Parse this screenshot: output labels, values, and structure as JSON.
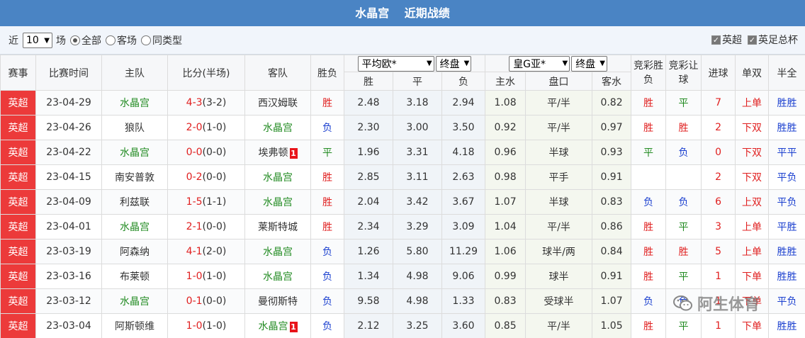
{
  "title": {
    "team": "水晶宫",
    "label": "近期战绩"
  },
  "filter": {
    "prefix": "近",
    "count": "10",
    "suffix": "场",
    "options": [
      "全部",
      "客场",
      "同类型"
    ],
    "selected": "全部",
    "checks": [
      "英超",
      "英足总杯"
    ]
  },
  "header": {
    "league": "赛事",
    "date": "比赛时间",
    "home": "主队",
    "score": "比分(半场)",
    "away": "客队",
    "result": "胜负",
    "euro_company": "平均欧*",
    "euro_mode": "终盘",
    "asia_company": "皇G亚*",
    "asia_mode": "终盘",
    "lottery_result": "竞彩胜负",
    "lottery_handicap": "竞彩让球",
    "goals": "进球",
    "odd_even": "单双",
    "half_full": "半全",
    "sub": {
      "w": "胜",
      "d": "平",
      "l": "负",
      "home_water": "主水",
      "line": "盘口",
      "away_water": "客水"
    }
  },
  "colors": {
    "title_bg": "#4a84c4",
    "league_bg": "#ec3a3a",
    "win": "#e02020",
    "lose": "#1a3fcf",
    "draw": "#228b22"
  },
  "rows": [
    {
      "league": "英超",
      "date": "23-04-29",
      "home": "水晶宫",
      "home_c": "green",
      "score": "4-3",
      "half": "(3-2)",
      "away": "西汉姆联",
      "away_c": "",
      "away_card": "",
      "home_card": "",
      "result": "胜",
      "w": "2.48",
      "d": "3.18",
      "l": "2.94",
      "hw": "1.08",
      "line": "平/半",
      "aw": "0.82",
      "lr": "胜",
      "lh": "平",
      "goals": "7",
      "oe": "上单",
      "hf": "胜胜"
    },
    {
      "league": "英超",
      "date": "23-04-26",
      "home": "狼队",
      "home_c": "",
      "score": "2-0",
      "half": "(1-0)",
      "away": "水晶宫",
      "away_c": "green",
      "away_card": "",
      "home_card": "",
      "result": "负",
      "w": "2.30",
      "d": "3.00",
      "l": "3.50",
      "hw": "0.92",
      "line": "平/半",
      "aw": "0.97",
      "lr": "胜",
      "lh": "胜",
      "goals": "2",
      "oe": "下双",
      "hf": "胜胜"
    },
    {
      "league": "英超",
      "date": "23-04-22",
      "home": "水晶宫",
      "home_c": "green",
      "score": "0-0",
      "half": "(0-0)",
      "away": "埃弗顿",
      "away_c": "",
      "away_card": "1",
      "home_card": "",
      "result": "平",
      "w": "1.96",
      "d": "3.31",
      "l": "4.18",
      "hw": "0.96",
      "line": "半球",
      "aw": "0.93",
      "lr": "平",
      "lh": "负",
      "goals": "0",
      "oe": "下双",
      "hf": "平平"
    },
    {
      "league": "英超",
      "date": "23-04-15",
      "home": "南安普敦",
      "home_c": "",
      "score": "0-2",
      "half": "(0-0)",
      "away": "水晶宫",
      "away_c": "green",
      "away_card": "",
      "home_card": "",
      "result": "胜",
      "w": "2.85",
      "d": "3.11",
      "l": "2.63",
      "hw": "0.98",
      "line": "平手",
      "aw": "0.91",
      "lr": "",
      "lh": "",
      "goals": "2",
      "oe": "下双",
      "hf": "平负"
    },
    {
      "league": "英超",
      "date": "23-04-09",
      "home": "利兹联",
      "home_c": "",
      "score": "1-5",
      "half": "(1-1)",
      "away": "水晶宫",
      "away_c": "green",
      "away_card": "",
      "home_card": "",
      "result": "胜",
      "w": "2.04",
      "d": "3.42",
      "l": "3.67",
      "hw": "1.07",
      "line": "半球",
      "aw": "0.83",
      "lr": "负",
      "lh": "负",
      "goals": "6",
      "oe": "上双",
      "hf": "平负"
    },
    {
      "league": "英超",
      "date": "23-04-01",
      "home": "水晶宫",
      "home_c": "green",
      "score": "2-1",
      "half": "(0-0)",
      "away": "莱斯特城",
      "away_c": "",
      "away_card": "",
      "home_card": "",
      "result": "胜",
      "w": "2.34",
      "d": "3.29",
      "l": "3.09",
      "hw": "1.04",
      "line": "平/半",
      "aw": "0.86",
      "lr": "胜",
      "lh": "平",
      "goals": "3",
      "oe": "上单",
      "hf": "平胜"
    },
    {
      "league": "英超",
      "date": "23-03-19",
      "home": "阿森纳",
      "home_c": "",
      "score": "4-1",
      "half": "(2-0)",
      "away": "水晶宫",
      "away_c": "green",
      "away_card": "",
      "home_card": "",
      "result": "负",
      "w": "1.26",
      "d": "5.80",
      "l": "11.29",
      "hw": "1.06",
      "line": "球半/两",
      "aw": "0.84",
      "lr": "胜",
      "lh": "胜",
      "goals": "5",
      "oe": "上单",
      "hf": "胜胜"
    },
    {
      "league": "英超",
      "date": "23-03-16",
      "home": "布莱顿",
      "home_c": "",
      "score": "1-0",
      "half": "(1-0)",
      "away": "水晶宫",
      "away_c": "green",
      "away_card": "",
      "home_card": "",
      "result": "负",
      "w": "1.34",
      "d": "4.98",
      "l": "9.06",
      "hw": "0.99",
      "line": "球半",
      "aw": "0.91",
      "lr": "胜",
      "lh": "平",
      "goals": "1",
      "oe": "下单",
      "hf": "胜胜"
    },
    {
      "league": "英超",
      "date": "23-03-12",
      "home": "水晶宫",
      "home_c": "green",
      "score": "0-1",
      "half": "(0-0)",
      "away": "曼彻斯特",
      "away_c": "",
      "away_card": "",
      "home_card": "",
      "result": "负",
      "w": "9.58",
      "d": "4.98",
      "l": "1.33",
      "hw": "0.83",
      "line": "受球半",
      "aw": "1.07",
      "lr": "负",
      "lh": "负",
      "goals": "1",
      "oe": "下单",
      "hf": "平负"
    },
    {
      "league": "英超",
      "date": "23-03-04",
      "home": "阿斯顿维",
      "home_c": "",
      "score": "1-0",
      "half": "(1-0)",
      "away": "水晶宫",
      "away_c": "green",
      "away_card": "1",
      "home_card": "",
      "result": "负",
      "w": "2.12",
      "d": "3.25",
      "l": "3.60",
      "hw": "0.85",
      "line": "平/半",
      "aw": "1.05",
      "lr": "胜",
      "lh": "平",
      "goals": "1",
      "oe": "下单",
      "hf": "胜胜"
    }
  ],
  "watermark": "阿生体育"
}
